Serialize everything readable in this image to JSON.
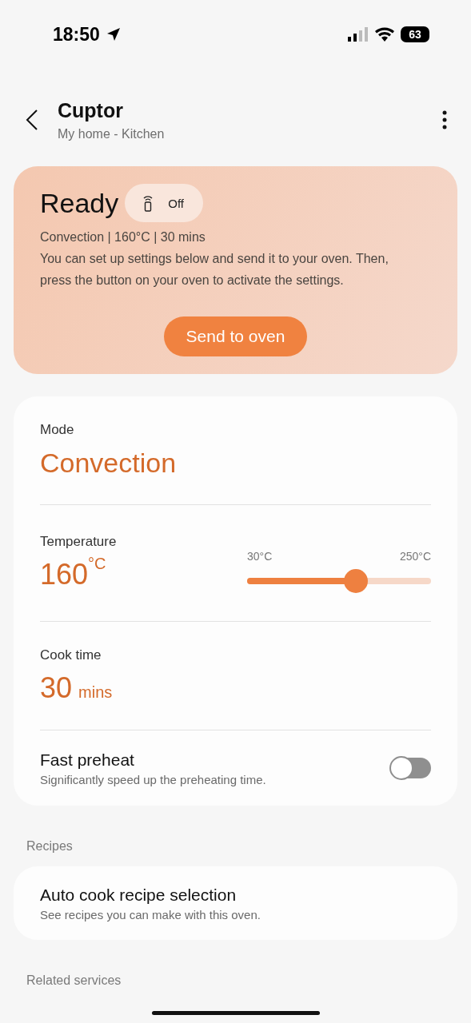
{
  "status_bar": {
    "time": "18:50",
    "battery": "63"
  },
  "header": {
    "title": "Cuptor",
    "subtitle": "My home - Kitchen"
  },
  "status_card": {
    "state": "Ready",
    "remote": {
      "label": "Off",
      "on": false
    },
    "summary": "Convection | 160°C | 30 mins",
    "description": "You can set up settings below and send it to your oven. Then, press the button on your oven to activate the settings.",
    "button": "Send to oven"
  },
  "settings": {
    "mode": {
      "label": "Mode",
      "value": "Convection"
    },
    "temperature": {
      "label": "Temperature",
      "value": "160",
      "unit": "°C",
      "min": "30°C",
      "max": "250°C",
      "level": 0.59
    },
    "cook_time": {
      "label": "Cook time",
      "value": "30",
      "unit": "mins"
    },
    "fast_preheat": {
      "title": "Fast preheat",
      "description": "Significantly speed up the preheating time.",
      "on": false
    }
  },
  "recipes": {
    "heading": "Recipes",
    "title": "Auto cook recipe selection",
    "description": "See recipes you can make with this oven."
  },
  "related": {
    "heading": "Related services"
  }
}
